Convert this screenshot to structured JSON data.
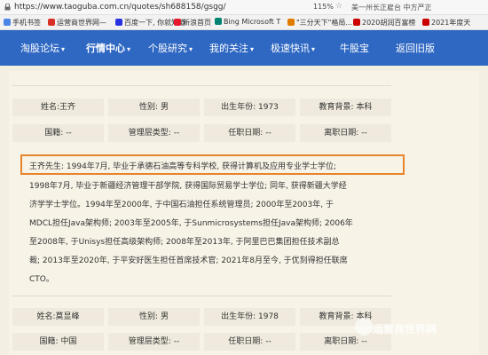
{
  "browser": {
    "url": "https://www.taoguba.com.cn/quotes/sh688158/gsgg/",
    "zoom": "115%",
    "search_hint": "美一州长正雇台 中方严正",
    "bookmarks": [
      "手机书签",
      "运营商世界网—",
      "百度一下, 你就知道",
      "新浪首页",
      "Bing Microsoft T",
      "\"三分天下\"格局...",
      "2020胡润百富榜",
      "2021年度天"
    ]
  },
  "nav": {
    "items": [
      "淘股论坛",
      "行情中心",
      "个股研究",
      "我的关注",
      "极速快讯",
      "牛股宝",
      "返回旧版"
    ],
    "active_index": 1
  },
  "person1": {
    "name": "姓名:王齐",
    "gender": "性别: 男",
    "birth": "出生年份: 1973",
    "education": "教育背景: 本科",
    "nationality": "国籍: --",
    "mgmt_type": "管理层类型: --",
    "appoint": "任职日期: --",
    "leave": "离职日期: --",
    "bio_lines": [
      "王齐先生: 1994年7月, 毕业于承德石油高等专科学校, 获得计算机及应用专业学士学位;",
      "1998年7月, 毕业于新疆经济管理干部学院, 获得国际贸易学士学位; 同年, 获得新疆大学经",
      "济学学士学位。1994年至2000年, 于中国石油担任系统管理员; 2000年至2003年, 于",
      "MDCL担任Java架构师; 2003年至2005年, 于Sunmicrosystems担任Java架构师; 2006年",
      "至2008年, 于Unisys担任高级架构师; 2008年至2013年, 于阿里巴巴集团担任技术副总",
      "裁; 2013年至2020年, 于平安好医生担任首席技术官; 2021年8月至今, 于优刻得担任联席",
      "CTO。"
    ]
  },
  "person2": {
    "name": "姓名:莫显峰",
    "gender": "性别: 男",
    "birth": "出生年份: 1978",
    "education": "教育背景: 本科",
    "nationality": "国籍: 中国",
    "mgmt_type": "管理层类型: --",
    "appoint": "任职日期: --",
    "leave": "离职日期: --"
  },
  "watermark": "运营商世界网",
  "colors": {
    "nav_bg": "#2f68c3",
    "page_bg": "#f3efe2",
    "cell_bg": "#efeadd",
    "highlight": "#e8842b"
  }
}
